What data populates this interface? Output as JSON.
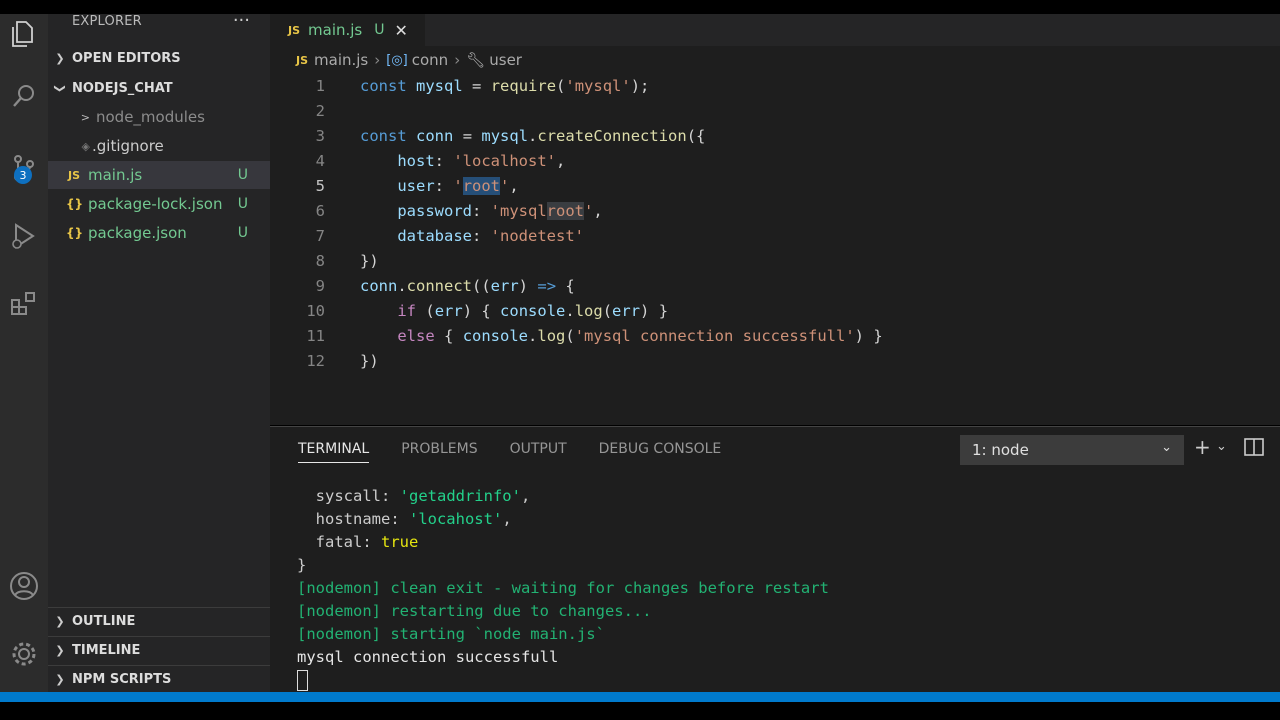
{
  "sidebar": {
    "title": "EXPLORER",
    "more": "···",
    "sections": {
      "open_editors": "OPEN EDITORS",
      "project": "NODEJS_CHAT",
      "outline": "OUTLINE",
      "timeline": "TIMELINE",
      "npm": "NPM SCRIPTS"
    },
    "files": [
      {
        "icon": ">",
        "name": "node_modules",
        "badge": ""
      },
      {
        "icon": "◈",
        "name": ".gitignore",
        "badge": ""
      },
      {
        "icon": "JS",
        "name": "main.js",
        "badge": "U"
      },
      {
        "icon": "{}",
        "name": "package-lock.json",
        "badge": "U"
      },
      {
        "icon": "{}",
        "name": "package.json",
        "badge": "U"
      }
    ]
  },
  "activity": {
    "scm_badge": "3"
  },
  "editor": {
    "tab": {
      "icon": "JS",
      "name": "main.js",
      "badge": "U",
      "close": "✕"
    },
    "breadcrumb": {
      "file": "main.js",
      "obj": "conn",
      "prop": "user"
    },
    "line_numbers": [
      "1",
      "2",
      "3",
      "4",
      "5",
      "6",
      "7",
      "8",
      "9",
      "10",
      "11",
      "12"
    ]
  },
  "panel": {
    "tabs": [
      "TERMINAL",
      "PROBLEMS",
      "OUTPUT",
      "DEBUG CONSOLE"
    ],
    "terminal_select": "1: node",
    "terminal_lines": {
      "l1_key": "  syscall: ",
      "l1_val": "'getaddrinfo'",
      "l1_end": ",",
      "l2_key": "  hostname: ",
      "l2_val": "'locahost'",
      "l2_end": ",",
      "l3_key": "  fatal: ",
      "l3_val": "true",
      "l4": "}",
      "l5": "[nodemon] clean exit - waiting for changes before restart",
      "l6": "[nodemon] restarting due to changes...",
      "l7": "[nodemon] starting `node main.js`",
      "l8": "mysql connection successfull"
    }
  },
  "colors": {
    "accent": "#007acc",
    "untracked": "#73c991",
    "js_icon": "#e8c547"
  }
}
